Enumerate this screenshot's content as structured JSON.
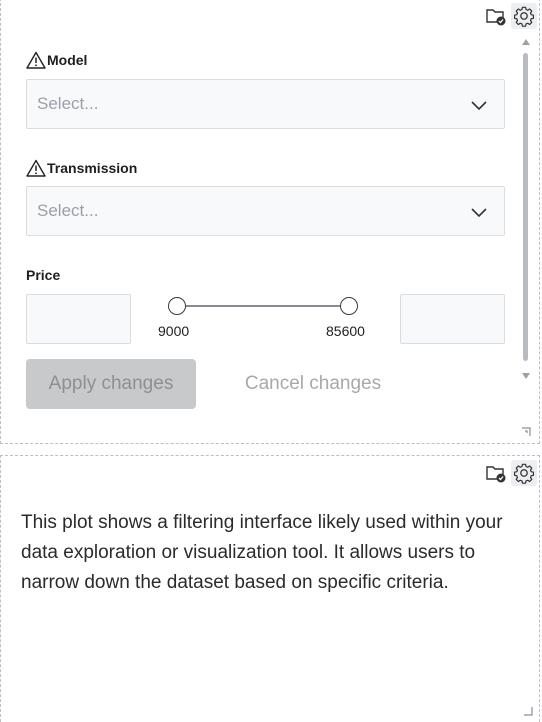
{
  "filter_panel": {
    "fields": [
      {
        "label": "Model",
        "placeholder": "Select..."
      },
      {
        "label": "Transmission",
        "placeholder": "Select..."
      }
    ],
    "price": {
      "label": "Price",
      "min_label": "9000",
      "max_label": "85600",
      "min_input": "",
      "max_input": ""
    },
    "apply_label": "Apply changes",
    "cancel_label": "Cancel changes"
  },
  "text_panel": {
    "description": "This plot shows a filtering interface likely used within your data exploration or visualization tool. It allows users to narrow down the dataset based on specific criteria."
  },
  "icons": {
    "tool_icons": [
      "folder-check-icon",
      "gear-icon"
    ],
    "field_icon": "warning-icon",
    "select_icon": "chevron-down-icon"
  },
  "colors": {
    "apply_bg": "#c8c9cb",
    "apply_text": "#8d8f92",
    "cancel_text": "#a6a9ad",
    "input_bg": "#f8f9fb",
    "panel_border": "#b8c0cc"
  }
}
